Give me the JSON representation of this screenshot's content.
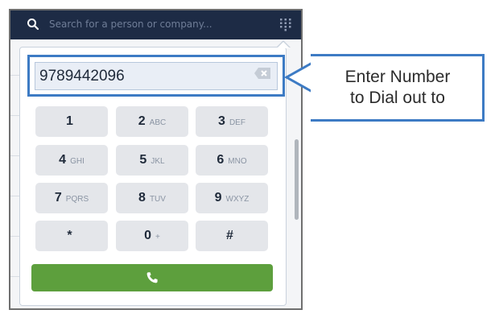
{
  "search": {
    "placeholder": "Search for a person or company..."
  },
  "dialer": {
    "number": "9789442096",
    "keys": [
      {
        "digit": "1",
        "letters": ""
      },
      {
        "digit": "2",
        "letters": "ABC"
      },
      {
        "digit": "3",
        "letters": "DEF"
      },
      {
        "digit": "4",
        "letters": "GHI"
      },
      {
        "digit": "5",
        "letters": "JKL"
      },
      {
        "digit": "6",
        "letters": "MNO"
      },
      {
        "digit": "7",
        "letters": "PQRS"
      },
      {
        "digit": "8",
        "letters": "TUV"
      },
      {
        "digit": "9",
        "letters": "WXYZ"
      },
      {
        "digit": "*",
        "letters": ""
      },
      {
        "digit": "0",
        "letters": "+"
      },
      {
        "digit": "#",
        "letters": ""
      }
    ],
    "call_icon": "phone-icon",
    "call_color": "#5d9f3d"
  },
  "callout": {
    "line1": "Enter Number",
    "line2": "to Dial out to"
  },
  "colors": {
    "topbar": "#1d2b45",
    "accent": "#3d7bc4"
  }
}
